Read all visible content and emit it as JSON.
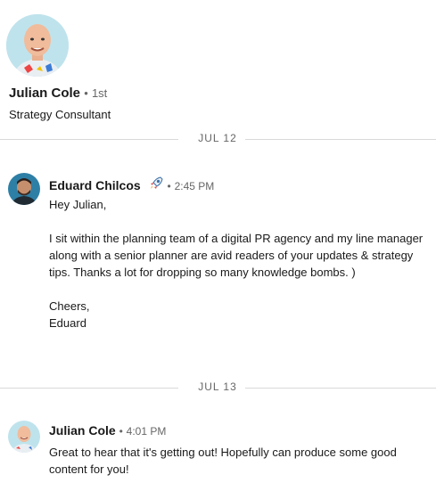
{
  "contact": {
    "name": "Julian Cole",
    "degree": "1st",
    "headline": "Strategy Consultant",
    "avatar_icon": "profile-photo-avatar"
  },
  "conversation": [
    {
      "date": "JUL 12",
      "sender": "Eduard Chilcos",
      "sender_badge_icon": "rocket-icon",
      "time": "2:45 PM",
      "text": "Hey Julian,\n\nI sit within the planning team of a digital PR agency and my line manager along with a senior planner are avid readers of your updates & strategy tips. Thanks a lot for dropping so many knowledge bombs. )\n\nCheers,\nEduard"
    },
    {
      "date": "JUL 13",
      "sender": "Julian Cole",
      "time": "4:01 PM",
      "text": "Great to hear that it's getting out! Hopefully can produce some good content for you!"
    }
  ],
  "separator": "•",
  "colors": {
    "divider": "#d9d9d9",
    "muted_text": "#666666",
    "primary_text": "#191919"
  }
}
